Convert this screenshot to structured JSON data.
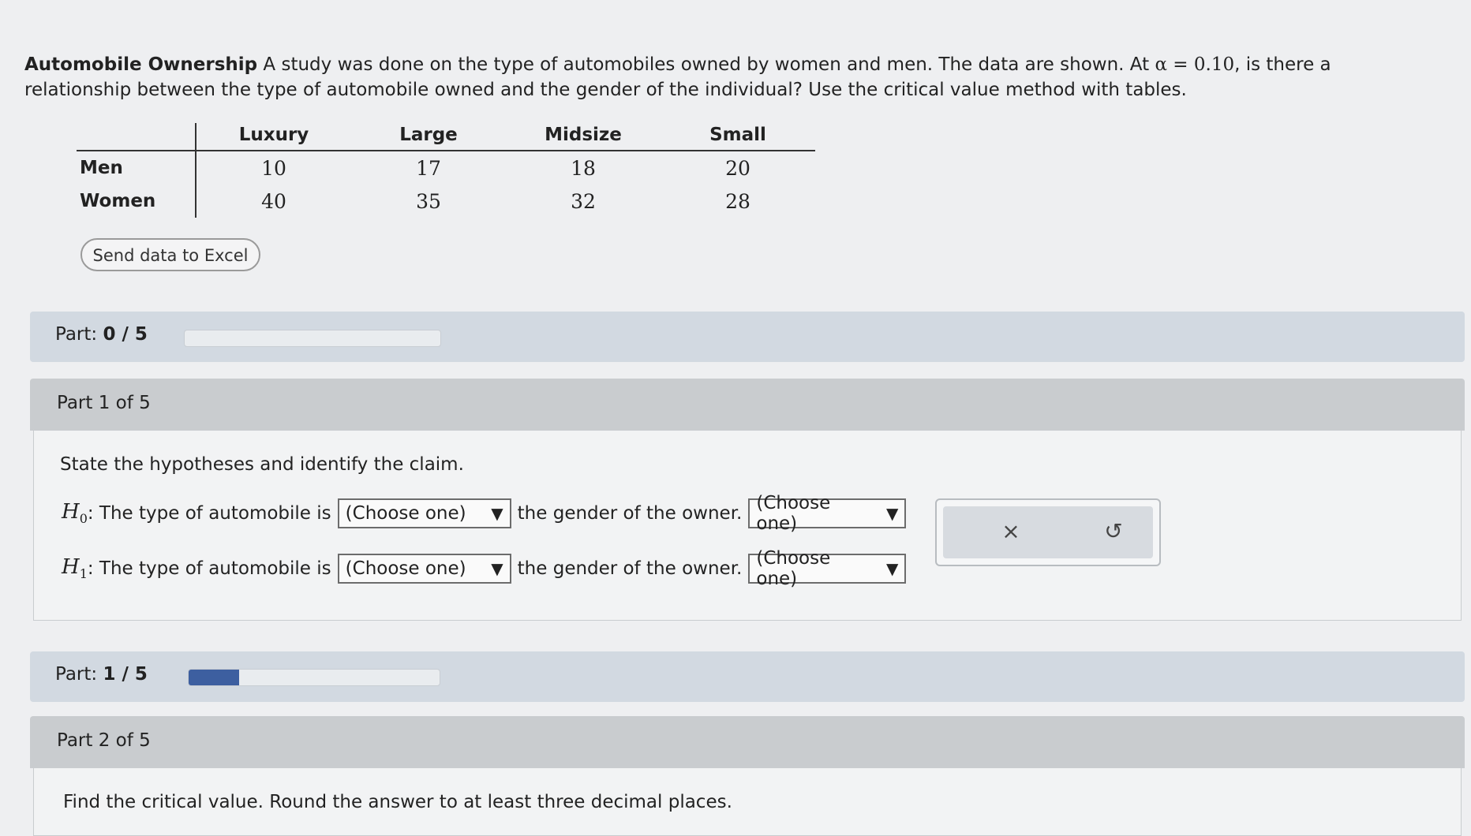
{
  "problem": {
    "title": "Automobile Ownership",
    "text_before_alpha": " A study was done on the type of automobiles owned by women and men. The data are shown. At ",
    "alpha_expr": "α = 0.10",
    "text_after_alpha": ", is there a relationship between the type of automobile owned and the gender of the individual? Use the critical value method with tables."
  },
  "table": {
    "columns": [
      "Luxury",
      "Large",
      "Midsize",
      "Small"
    ],
    "rows": [
      {
        "label": "Men",
        "values": [
          "10",
          "17",
          "18",
          "20"
        ]
      },
      {
        "label": "Women",
        "values": [
          "40",
          "35",
          "32",
          "28"
        ]
      }
    ]
  },
  "send_excel_label": "Send data to Excel",
  "progress1": {
    "label": "Part: ",
    "value": "0 / 5",
    "fraction": 0.0
  },
  "progress2": {
    "label": "Part: ",
    "value": "1 / 5",
    "fraction": 0.2
  },
  "part1": {
    "header": "Part 1 of 5",
    "prompt": "State the hypotheses and identify the claim.",
    "h0_label": "0",
    "h1_label": "1",
    "lead": ": The type of automobile is",
    "middle": "the gender of the owner.",
    "select_placeholder": "(Choose one)"
  },
  "part2": {
    "header": "Part 2 of 5",
    "prompt": "Find the critical value. Round the answer to at least three decimal places."
  },
  "actions": {
    "clear_icon": "×",
    "reset_icon": "↺"
  }
}
